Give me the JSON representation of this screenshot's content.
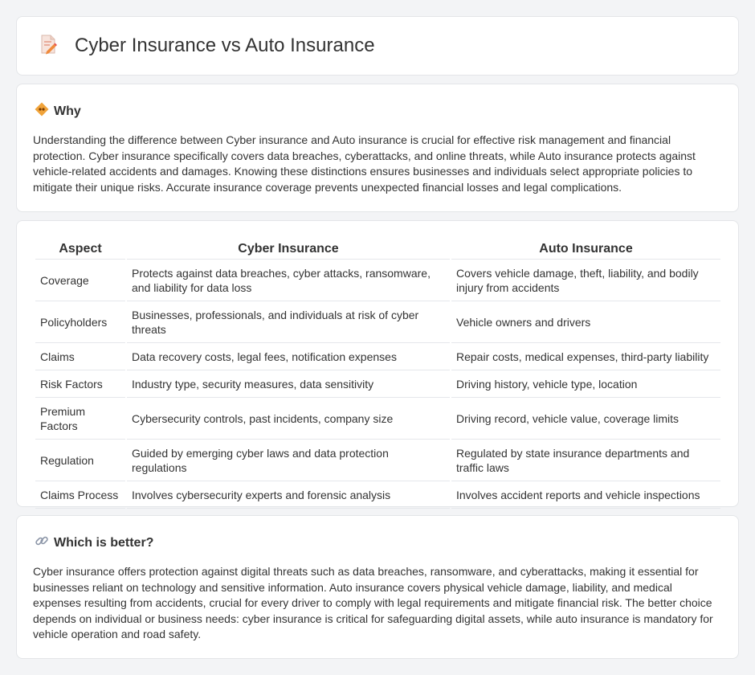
{
  "header": {
    "title": "Cyber Insurance vs Auto Insurance",
    "icon": "document-pencil-icon"
  },
  "why": {
    "heading": "Why",
    "icon": "diamond-sign-icon",
    "text": "Understanding the difference between Cyber insurance and Auto insurance is crucial for effective risk management and financial protection. Cyber insurance specifically covers data breaches, cyberattacks, and online threats, while Auto insurance protects against vehicle-related accidents and damages. Knowing these distinctions ensures businesses and individuals select appropriate policies to mitigate their unique risks. Accurate insurance coverage prevents unexpected financial losses and legal complications."
  },
  "table": {
    "headers": [
      "Aspect",
      "Cyber Insurance",
      "Auto Insurance"
    ],
    "rows": [
      [
        "Coverage",
        "Protects against data breaches, cyber attacks, ransomware, and liability for data loss",
        "Covers vehicle damage, theft, liability, and bodily injury from accidents"
      ],
      [
        "Policyholders",
        "Businesses, professionals, and individuals at risk of cyber threats",
        "Vehicle owners and drivers"
      ],
      [
        "Claims",
        "Data recovery costs, legal fees, notification expenses",
        "Repair costs, medical expenses, third-party liability"
      ],
      [
        "Risk Factors",
        "Industry type, security measures, data sensitivity",
        "Driving history, vehicle type, location"
      ],
      [
        "Premium Factors",
        "Cybersecurity controls, past incidents, company size",
        "Driving record, vehicle value, coverage limits"
      ],
      [
        "Regulation",
        "Guided by emerging cyber laws and data protection regulations",
        "Regulated by state insurance departments and traffic laws"
      ],
      [
        "Claims Process",
        "Involves cybersecurity experts and forensic analysis",
        "Involves accident reports and vehicle inspections"
      ]
    ]
  },
  "better": {
    "heading": "Which is better?",
    "icon": "link-icon",
    "text": "Cyber insurance offers protection against digital threats such as data breaches, ransomware, and cyberattacks, making it essential for businesses reliant on technology and sensitive information. Auto insurance covers physical vehicle damage, liability, and medical expenses resulting from accidents, crucial for every driver to comply with legal requirements and mitigate financial risk. The better choice depends on individual or business needs: cyber insurance is critical for safeguarding digital assets, while auto insurance is mandatory for vehicle operation and road safety."
  },
  "colors": {
    "page_bg": "#f3f4f6",
    "card_bg": "#ffffff",
    "text": "#333333",
    "accent_orange": "#f0a33a"
  }
}
